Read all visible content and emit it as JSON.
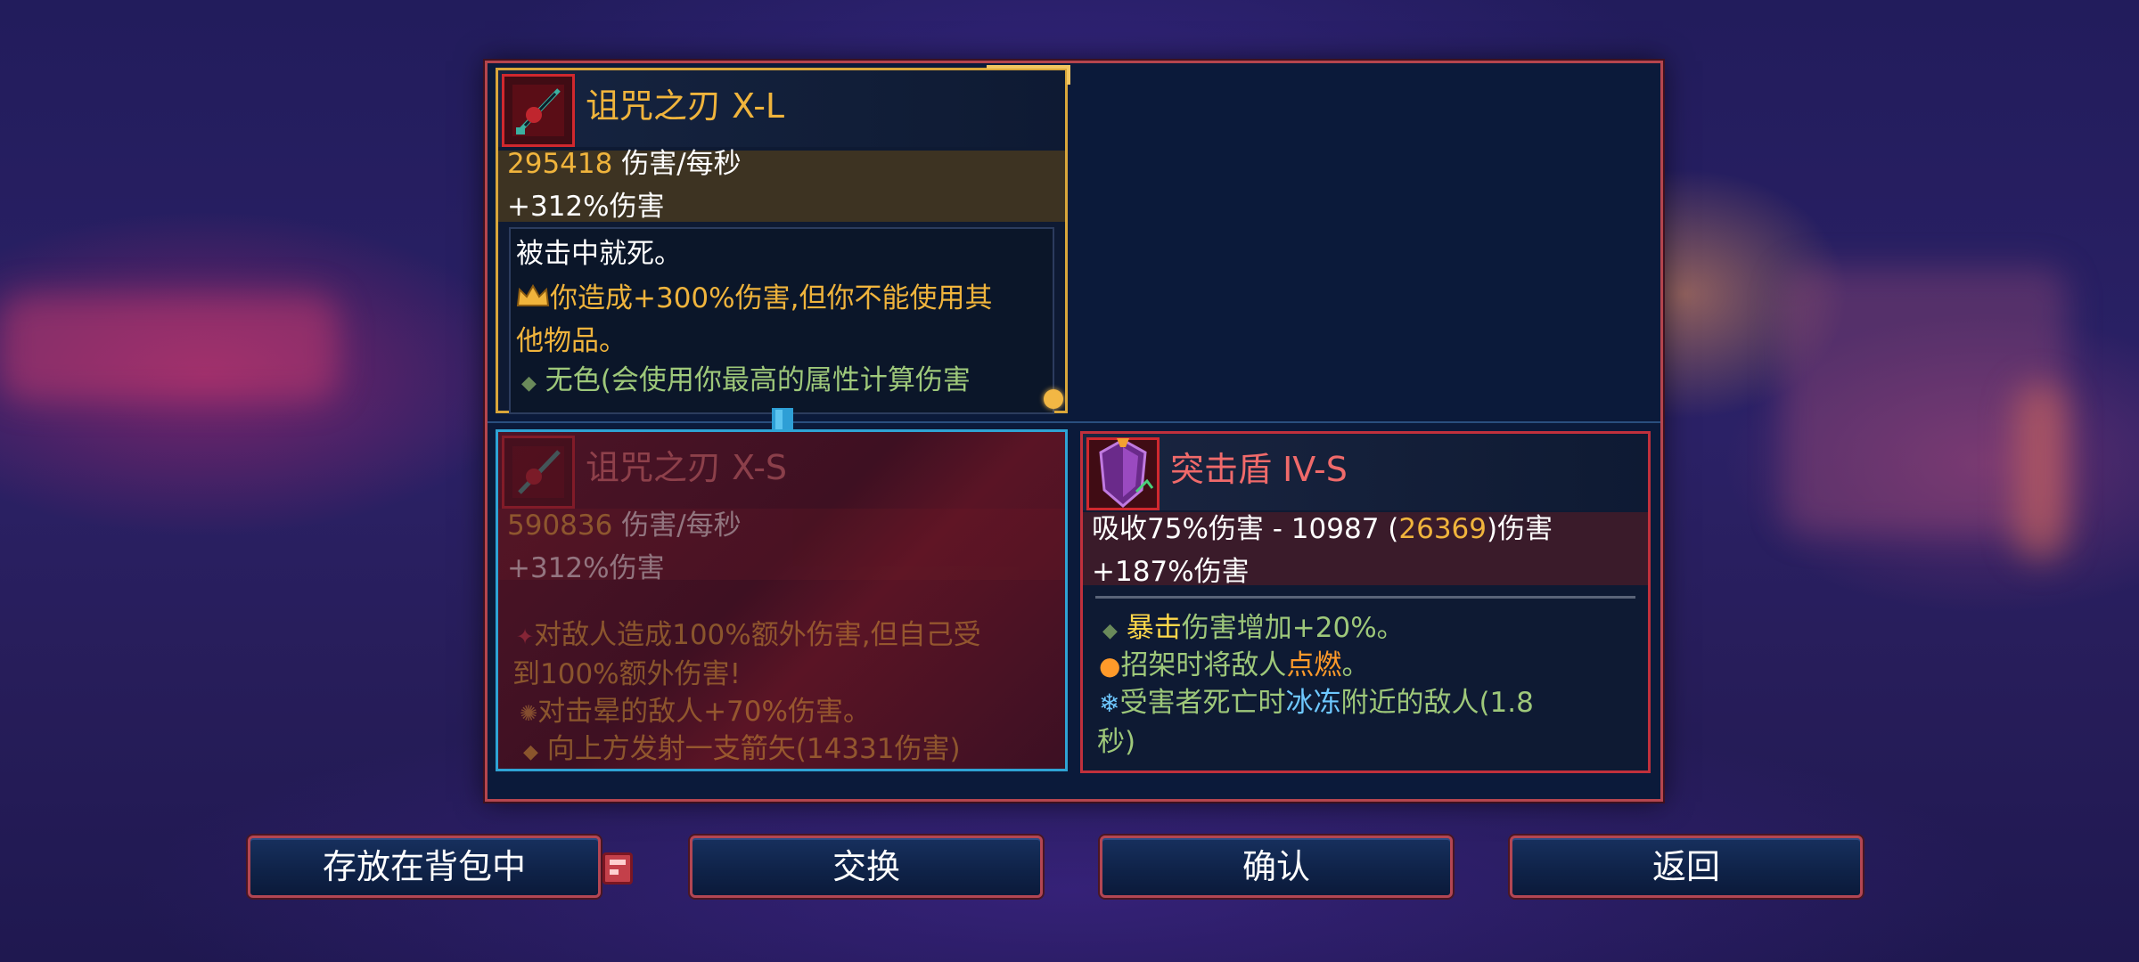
{
  "current_item": {
    "name": "诅咒之刃 X-L",
    "dps_value": "295418",
    "dps_unit": " 伤害/每秒",
    "bonus": "+312%伤害",
    "curse_text": "被击中就死。",
    "affix_main": "你造成+300%伤害,但你不能使用其",
    "affix_main_cont": "他物品。",
    "affix_scaling": "无色(会使用你最高的属性计算伤害"
  },
  "new_item": {
    "name": "诅咒之刃 X-S",
    "dps_value": "590836",
    "dps_unit": " 伤害/每秒",
    "bonus": "+312%伤害",
    "affix_1": "对敌人造成100%额外伤害,但自己受",
    "affix_1_cont": "到100%额外伤害!",
    "affix_2": "对击晕的敌人+70%伤害。",
    "affix_3": "向上方发射一支箭矢(14331伤害)"
  },
  "shield_item": {
    "name": "突击盾 IV-S",
    "absorb_prefix": "吸收75%伤害 - 10987 (",
    "absorb_value": "26369",
    "absorb_suffix": ")伤害",
    "bonus": "+187%伤害",
    "affix_crit_a": "暴击",
    "affix_crit_b": "伤害增加+20%。",
    "affix_parry_a": "招架时将敌人",
    "affix_parry_b": "点燃",
    "affix_parry_c": "。",
    "affix_freeze_a": "受害者死亡时",
    "affix_freeze_b": "冰冻",
    "affix_freeze_c": "附近的敌人(1.8",
    "affix_freeze_cont": "秒)"
  },
  "buttons": {
    "store": "存放在背包中",
    "swap": "交换",
    "confirm": "确认",
    "back": "返回"
  },
  "icons": {
    "current_weapon": "cursed-sword-icon",
    "new_weapon": "cursed-sword-icon",
    "shield": "assault-shield-icon",
    "crown": "crown-icon",
    "swap_arrow": "arrow-down-icon",
    "backpack_tag": "backpack-icon"
  },
  "colors": {
    "legendary_gold": "#f0b43c",
    "colorless_green": "#9ec87a",
    "crit_yellow": "#ffd84a",
    "burn_orange": "#ff9a2a",
    "freeze_blue": "#6ec8ff",
    "panel_border": "#b5454e",
    "new_item_border": "#2fa3d4"
  }
}
